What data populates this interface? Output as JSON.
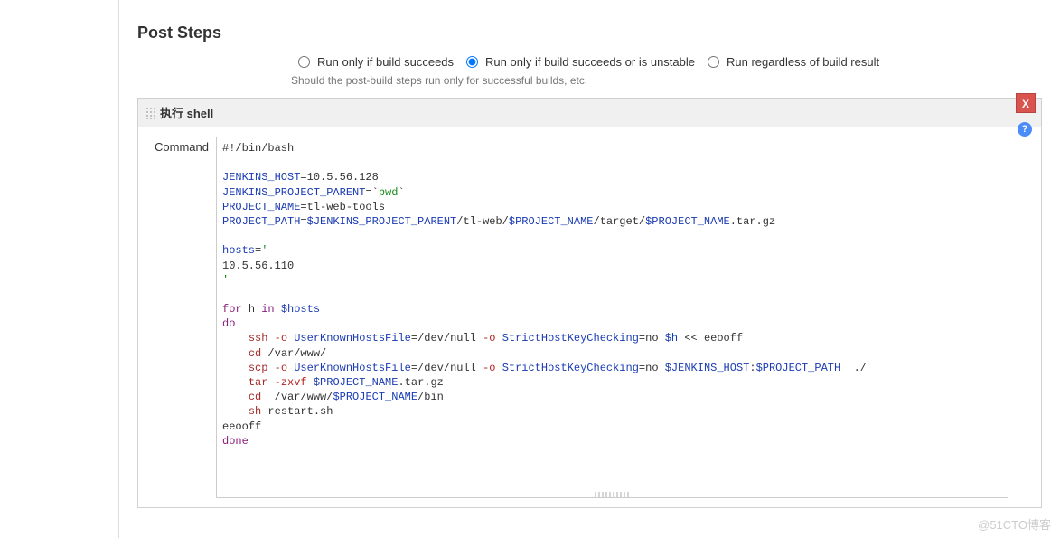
{
  "section": {
    "title": "Post Steps"
  },
  "radios": {
    "opt1": "Run only if build succeeds",
    "opt2": "Run only if build succeeds or is unstable",
    "opt3": "Run regardless of build result",
    "selected": 1,
    "help": "Should the post-build steps run only for successful builds, etc."
  },
  "step": {
    "title": "执行 shell",
    "delete": "X",
    "help_icon": "?",
    "field_label": "Command"
  },
  "script": {
    "shebang": "#!/bin/bash",
    "assign": {
      "jenkins_host": {
        "name": "JENKINS_HOST",
        "value": "10.5.56.128"
      },
      "jenkins_project_parent": {
        "name": "JENKINS_PROJECT_PARENT",
        "cmd": "pwd"
      },
      "project_name": {
        "name": "PROJECT_NAME",
        "value": "tl-web-tools"
      },
      "project_path": {
        "name": "PROJECT_PATH",
        "parts": {
          "p1": "$JENKINS_PROJECT_PARENT",
          "p2": "/tl-web/",
          "p3": "$PROJECT_NAME",
          "p4": "/target/",
          "p5": "$PROJECT_NAME",
          "p6": ".tar.gz"
        }
      }
    },
    "hosts": {
      "name": "hosts",
      "open_quote": "'",
      "value": "10.5.56.110",
      "close_quote": "'"
    },
    "loop": {
      "kw_for": "for",
      "var_h": "h",
      "kw_in": "in",
      "var_hosts": "$hosts",
      "kw_do": "do",
      "kw_done": "done",
      "heredoc_end": "eeooff",
      "lines": {
        "ssh": {
          "cmd": "ssh",
          "opt_o": "-o",
          "kv1": "UserKnownHostsFile",
          "kv1v": "/dev/null",
          "kv2": "StrictHostKeyChecking",
          "kv2v": "no",
          "target": "$h",
          "heredoc": "<< eeooff"
        },
        "cd1": {
          "cmd": "cd",
          "path": "/var/www/"
        },
        "scp": {
          "cmd": "scp",
          "opt_o": "-o",
          "kv1": "UserKnownHostsFile",
          "kv1v": "/dev/null",
          "kv2": "StrictHostKeyChecking",
          "kv2v": "no",
          "src_host": "$JENKINS_HOST",
          "colon": ":",
          "src_path": "$PROJECT_PATH",
          "dst": "./"
        },
        "tar": {
          "cmd": "tar",
          "opt": "-zxvf",
          "file_var": "$PROJECT_NAME",
          "file_suffix": ".tar.gz"
        },
        "cd2": {
          "cmd": "cd",
          "p1": "/var/www/",
          "var": "$PROJECT_NAME",
          "p2": "/bin"
        },
        "sh": {
          "cmd": "sh",
          "file": "restart.sh"
        }
      }
    }
  },
  "watermark": "@51CTO博客"
}
